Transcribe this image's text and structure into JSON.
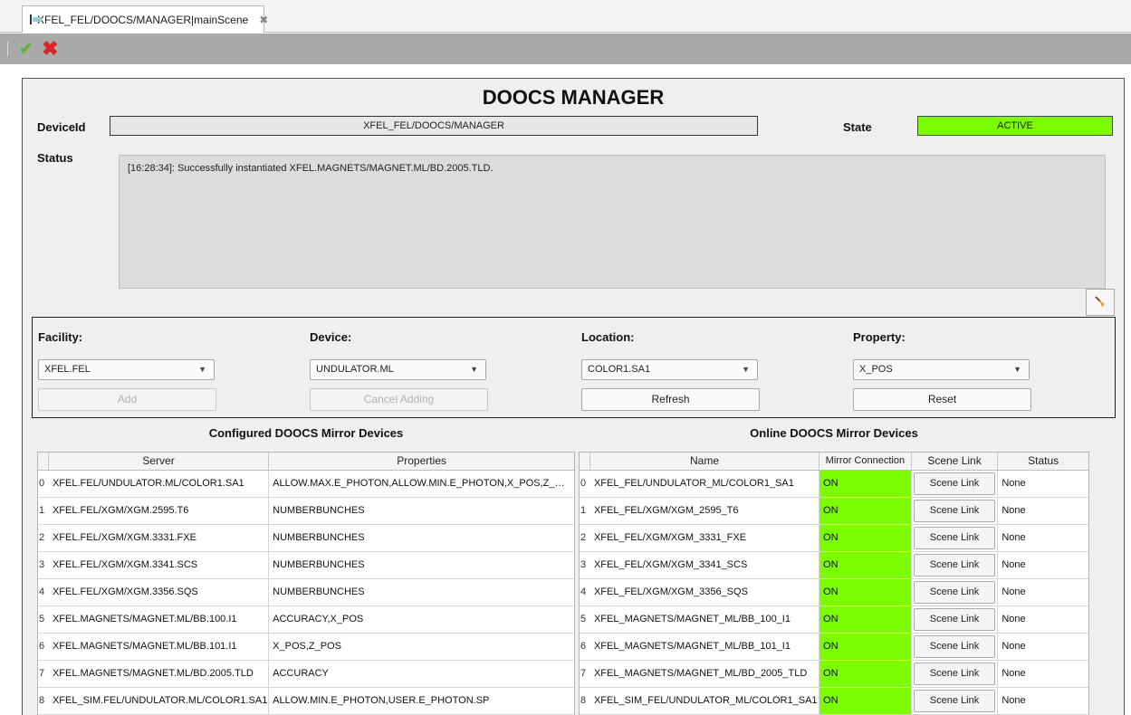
{
  "tab": {
    "title": "XFEL_FEL/DOOCS/MANAGER|mainScene",
    "close": "✖"
  },
  "toolbar": {
    "apply_icon": "✔",
    "cancel_icon": "✖"
  },
  "scene": {
    "title": "DOOCS MANAGER",
    "device_id_label": "DeviceId",
    "device_id_value": "XFEL_FEL/DOOCS/MANAGER",
    "state_label": "State",
    "state_value": "ACTIVE",
    "state_color": "#7cfc00",
    "status_label": "Status",
    "status_text": "[16:28:34]: Successfully instantiated XFEL.MAGNETS/MAGNET.ML/BD.2005.TLD."
  },
  "filters": {
    "facility": {
      "label": "Facility:",
      "value": "XFEL.FEL",
      "button": "Add"
    },
    "device": {
      "label": "Device:",
      "value": "UNDULATOR.ML",
      "button": "Cancel Adding"
    },
    "location": {
      "label": "Location:",
      "value": "COLOR1.SA1",
      "button": "Refresh"
    },
    "property": {
      "label": "Property:",
      "value": "X_POS",
      "button": "Reset"
    }
  },
  "configured": {
    "title": "Configured DOOCS Mirror Devices",
    "headers": [
      "Server",
      "Properties"
    ],
    "rows": [
      {
        "idx": "0",
        "server": "XFEL.FEL/UNDULATOR.ML/COLOR1.SA1",
        "properties": "ALLOW.MAX.E_PHOTON,ALLOW.MIN.E_PHOTON,X_POS,Z_…"
      },
      {
        "idx": "1",
        "server": "XFEL.FEL/XGM/XGM.2595.T6",
        "properties": "NUMBERBUNCHES"
      },
      {
        "idx": "2",
        "server": "XFEL.FEL/XGM/XGM.3331.FXE",
        "properties": "NUMBERBUNCHES"
      },
      {
        "idx": "3",
        "server": "XFEL.FEL/XGM/XGM.3341.SCS",
        "properties": "NUMBERBUNCHES"
      },
      {
        "idx": "4",
        "server": "XFEL.FEL/XGM/XGM.3356.SQS",
        "properties": "NUMBERBUNCHES"
      },
      {
        "idx": "5",
        "server": "XFEL.MAGNETS/MAGNET.ML/BB.100.I1",
        "properties": "ACCURACY,X_POS"
      },
      {
        "idx": "6",
        "server": "XFEL.MAGNETS/MAGNET.ML/BB.101.I1",
        "properties": "X_POS,Z_POS"
      },
      {
        "idx": "7",
        "server": "XFEL.MAGNETS/MAGNET.ML/BD.2005.TLD",
        "properties": "ACCURACY"
      },
      {
        "idx": "8",
        "server": "XFEL_SIM.FEL/UNDULATOR.ML/COLOR1.SA1",
        "properties": "ALLOW.MIN.E_PHOTON,USER.E_PHOTON.SP"
      }
    ]
  },
  "online": {
    "title": "Online DOOCS Mirror Devices",
    "headers": [
      "Name",
      "Mirror Connection",
      "Scene Link",
      "Status"
    ],
    "on_color": "#7cfc00",
    "rows": [
      {
        "idx": "0",
        "name": "XFEL_FEL/UNDULATOR_ML/COLOR1_SA1",
        "connection": "ON",
        "link": "Scene Link",
        "status": "None"
      },
      {
        "idx": "1",
        "name": "XFEL_FEL/XGM/XGM_2595_T6",
        "connection": "ON",
        "link": "Scene Link",
        "status": "None"
      },
      {
        "idx": "2",
        "name": "XFEL_FEL/XGM/XGM_3331_FXE",
        "connection": "ON",
        "link": "Scene Link",
        "status": "None"
      },
      {
        "idx": "3",
        "name": "XFEL_FEL/XGM/XGM_3341_SCS",
        "connection": "ON",
        "link": "Scene Link",
        "status": "None"
      },
      {
        "idx": "4",
        "name": "XFEL_FEL/XGM/XGM_3356_SQS",
        "connection": "ON",
        "link": "Scene Link",
        "status": "None"
      },
      {
        "idx": "5",
        "name": "XFEL_MAGNETS/MAGNET_ML/BB_100_I1",
        "connection": "ON",
        "link": "Scene Link",
        "status": "None"
      },
      {
        "idx": "6",
        "name": "XFEL_MAGNETS/MAGNET_ML/BB_101_I1",
        "connection": "ON",
        "link": "Scene Link",
        "status": "None"
      },
      {
        "idx": "7",
        "name": "XFEL_MAGNETS/MAGNET_ML/BD_2005_TLD",
        "connection": "ON",
        "link": "Scene Link",
        "status": "None"
      },
      {
        "idx": "8",
        "name": "XFEL_SIM_FEL/UNDULATOR_ML/COLOR1_SA1",
        "connection": "ON",
        "link": "Scene Link",
        "status": "None"
      }
    ]
  }
}
